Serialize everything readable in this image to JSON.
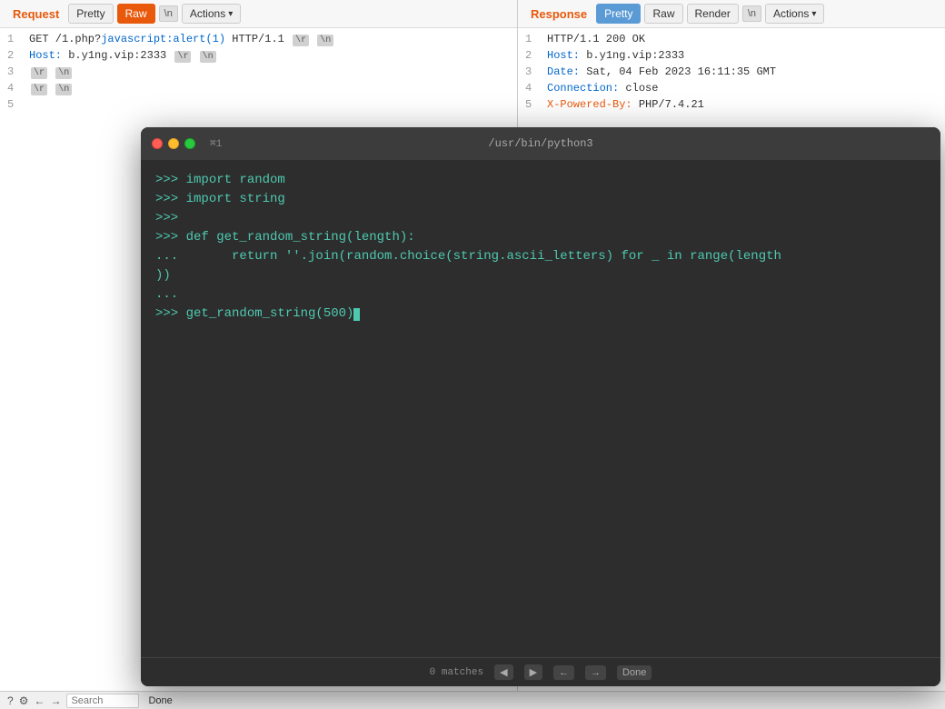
{
  "request": {
    "title": "Request",
    "tabs": [
      {
        "label": "Pretty",
        "active": false
      },
      {
        "label": "Raw",
        "active": true
      },
      {
        "label": "\\n",
        "active": false
      }
    ],
    "actions_label": "Actions",
    "lines": [
      {
        "num": "1",
        "content": "GET /1.php?javascript:alert(1) HTTP/1.1",
        "badges": [
          "\\r",
          "\\n"
        ]
      },
      {
        "num": "2",
        "content": "Host: b.y1ng.vip:2333",
        "badges": [
          "\\r",
          "\\n"
        ]
      },
      {
        "num": "3",
        "badges": [
          "\\r",
          "\\n"
        ]
      },
      {
        "num": "4",
        "badges": [
          "\\r",
          "\\n"
        ]
      },
      {
        "num": "5",
        "content": ""
      }
    ]
  },
  "response": {
    "title": "Response",
    "tabs": [
      {
        "label": "Pretty",
        "active": true
      },
      {
        "label": "Raw",
        "active": false
      },
      {
        "label": "Render",
        "active": false
      },
      {
        "label": "\\n",
        "active": false
      }
    ],
    "actions_label": "Actions",
    "lines": [
      {
        "num": "1",
        "content": "HTTP/1.1 200 OK"
      },
      {
        "num": "2",
        "content_parts": [
          {
            "text": "Host:",
            "class": "header-name"
          },
          {
            "text": " b.y1ng.vip:2333",
            "class": "header-val"
          }
        ]
      },
      {
        "num": "3",
        "content_parts": [
          {
            "text": "Date:",
            "class": "header-name"
          },
          {
            "text": " Sat, 04 Feb 2023 16:11:35 GMT",
            "class": "header-val"
          }
        ]
      },
      {
        "num": "4",
        "content_parts": [
          {
            "text": "Connection:",
            "class": "header-name"
          },
          {
            "text": " close",
            "class": "header-val"
          }
        ]
      },
      {
        "num": "5",
        "content_parts": [
          {
            "text": "X-Powered-By:",
            "class": "powered-by"
          },
          {
            "text": " PHP/7.4.21",
            "class": "header-val"
          }
        ]
      }
    ]
  },
  "terminal": {
    "title": "/usr/bin/python3",
    "shortcut": "⌘1",
    "lines": [
      {
        "prompt": ">>> ",
        "cmd": "import random"
      },
      {
        "prompt": ">>> ",
        "cmd": "import string"
      },
      {
        "prompt": ">>> ",
        "cmd": ""
      },
      {
        "prompt": ">>> ",
        "cmd": "def get_random_string(length):"
      },
      {
        "prompt": "... ",
        "cmd": "      return ''.join(random.choice(string.ascii_letters) for _ in range(length"
      },
      {
        "prompt": ")",
        "cmd": ")"
      },
      {
        "prompt": "... ",
        "cmd": ""
      },
      {
        "prompt": ">>> ",
        "cmd": "get_random_string(500)"
      }
    ],
    "bottom": {
      "matches_label": "0 matches",
      "done_label": "Done"
    }
  },
  "bottom_bar": {
    "status": "Done",
    "search_placeholder": "Search"
  },
  "icons": {
    "help": "?",
    "settings": "⚙",
    "back": "←",
    "forward": "→",
    "prev_match": "◀",
    "next_match": "▶"
  }
}
